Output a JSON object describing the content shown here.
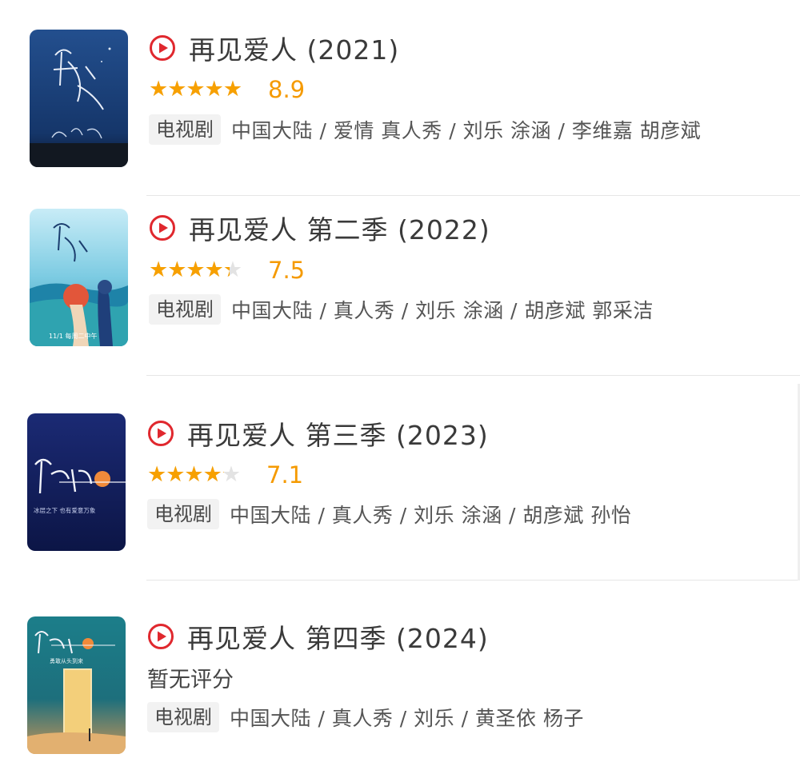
{
  "shows": [
    {
      "title": "再见爱人 (2021)",
      "rating": 8.9,
      "score_text": "8.9",
      "no_rating_text": "",
      "type": "电视剧",
      "meta": "中国大陆 / 爱情 真人秀 / 刘乐 涂涵 / 李维嘉 胡彦斌",
      "poster_colors": [
        "#1e4a86",
        "#0f2850"
      ]
    },
    {
      "title": "再见爱人 第二季 (2022)",
      "rating": 7.5,
      "score_text": "7.5",
      "no_rating_text": "",
      "type": "电视剧",
      "meta": "中国大陆 / 真人秀 / 刘乐 涂涵 / 胡彦斌 郭采洁",
      "poster_colors": [
        "#aee0f2",
        "#2f9ab8"
      ]
    },
    {
      "title": "再见爱人 第三季 (2023)",
      "rating": 7.1,
      "score_text": "7.1",
      "no_rating_text": "",
      "type": "电视剧",
      "meta": "中国大陆 / 真人秀 / 刘乐 涂涵 / 胡彦斌 孙怡",
      "poster_colors": [
        "#1d2c78",
        "#0e1648"
      ]
    },
    {
      "title": "再见爱人 第四季 (2024)",
      "rating": null,
      "score_text": "",
      "no_rating_text": "暂无评分",
      "type": "电视剧",
      "meta": "中国大陆 / 真人秀 / 刘乐 / 黄圣依 杨子",
      "poster_colors": [
        "#1a7a86",
        "#e2a860"
      ]
    }
  ],
  "colors": {
    "play_icon": "#e0282e",
    "star": "#f7a000",
    "score": "#f59a00"
  },
  "icons": {
    "play": "play-circle-icon",
    "star": "star-icon"
  }
}
